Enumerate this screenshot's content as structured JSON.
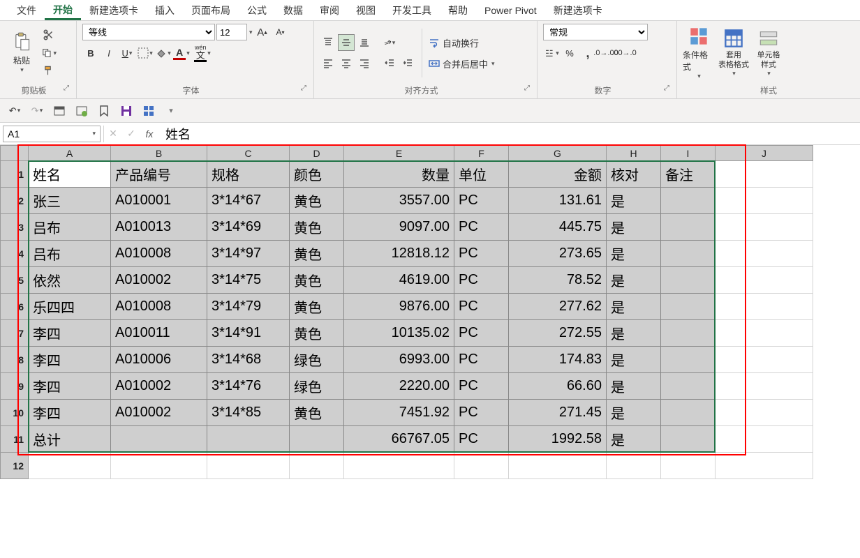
{
  "menu": [
    "文件",
    "开始",
    "新建选项卡",
    "插入",
    "页面布局",
    "公式",
    "数据",
    "审阅",
    "视图",
    "开发工具",
    "帮助",
    "Power Pivot",
    "新建选项卡"
  ],
  "menu_active_index": 1,
  "ribbon": {
    "clipboard": {
      "label": "剪贴板",
      "paste": "粘贴"
    },
    "font": {
      "label": "字体",
      "font_name": "等线",
      "font_size": "12",
      "bold": "B",
      "italic": "I",
      "underline": "U",
      "wen": "wén",
      "wen2": "文"
    },
    "alignment": {
      "label": "对齐方式",
      "wrap": "自动换行",
      "merge": "合并后居中"
    },
    "number": {
      "label": "数字",
      "format": "常规"
    },
    "styles": {
      "label": "样式",
      "cond": "条件格式",
      "table": "套用\n表格格式",
      "cell": "单元格样式"
    }
  },
  "namebox": "A1",
  "formula": "姓名",
  "columns": [
    "A",
    "B",
    "C",
    "D",
    "E",
    "F",
    "G",
    "H",
    "I",
    "J"
  ],
  "col_widths": [
    "colA",
    "colB",
    "colC",
    "colD",
    "colE",
    "colF",
    "colG",
    "colH",
    "colI",
    "colJ"
  ],
  "headers": [
    "姓名",
    "产品编号",
    "规格",
    "颜色",
    "数量",
    "单位",
    "金额",
    "核对",
    "备注"
  ],
  "rows": [
    {
      "name": "张三",
      "code": "A010001",
      "spec": "3*14*67",
      "color": "黄色",
      "qty": "3557.00",
      "unit": "PC",
      "amt": "131.61",
      "check": "是",
      "note": ""
    },
    {
      "name": "吕布",
      "code": "A010013",
      "spec": "3*14*69",
      "color": "黄色",
      "qty": "9097.00",
      "unit": "PC",
      "amt": "445.75",
      "check": "是",
      "note": ""
    },
    {
      "name": "吕布",
      "code": "A010008",
      "spec": "3*14*97",
      "color": "黄色",
      "qty": "12818.12",
      "unit": "PC",
      "amt": "273.65",
      "check": "是",
      "note": ""
    },
    {
      "name": "依然",
      "code": "A010002",
      "spec": "3*14*75",
      "color": "黄色",
      "qty": "4619.00",
      "unit": "PC",
      "amt": "78.52",
      "check": "是",
      "note": ""
    },
    {
      "name": "乐四四",
      "code": "A010008",
      "spec": "3*14*79",
      "color": "黄色",
      "qty": "9876.00",
      "unit": "PC",
      "amt": "277.62",
      "check": "是",
      "note": ""
    },
    {
      "name": "李四",
      "code": "A010011",
      "spec": "3*14*91",
      "color": "黄色",
      "qty": "10135.02",
      "unit": "PC",
      "amt": "272.55",
      "check": "是",
      "note": ""
    },
    {
      "name": "李四",
      "code": "A010006",
      "spec": "3*14*68",
      "color": "绿色",
      "qty": "6993.00",
      "unit": "PC",
      "amt": "174.83",
      "check": "是",
      "note": ""
    },
    {
      "name": "李四",
      "code": "A010002",
      "spec": "3*14*76",
      "color": "绿色",
      "qty": "2220.00",
      "unit": "PC",
      "amt": "66.60",
      "check": "是",
      "note": ""
    },
    {
      "name": "李四",
      "code": "A010002",
      "spec": "3*14*85",
      "color": "黄色",
      "qty": "7451.92",
      "unit": "PC",
      "amt": "271.45",
      "check": "是",
      "note": ""
    }
  ],
  "total_row": {
    "name": "总计",
    "code": "",
    "spec": "",
    "color": "",
    "qty": "66767.05",
    "unit": "PC",
    "amt": "1992.58",
    "check": "是",
    "note": ""
  },
  "row_count": 12
}
